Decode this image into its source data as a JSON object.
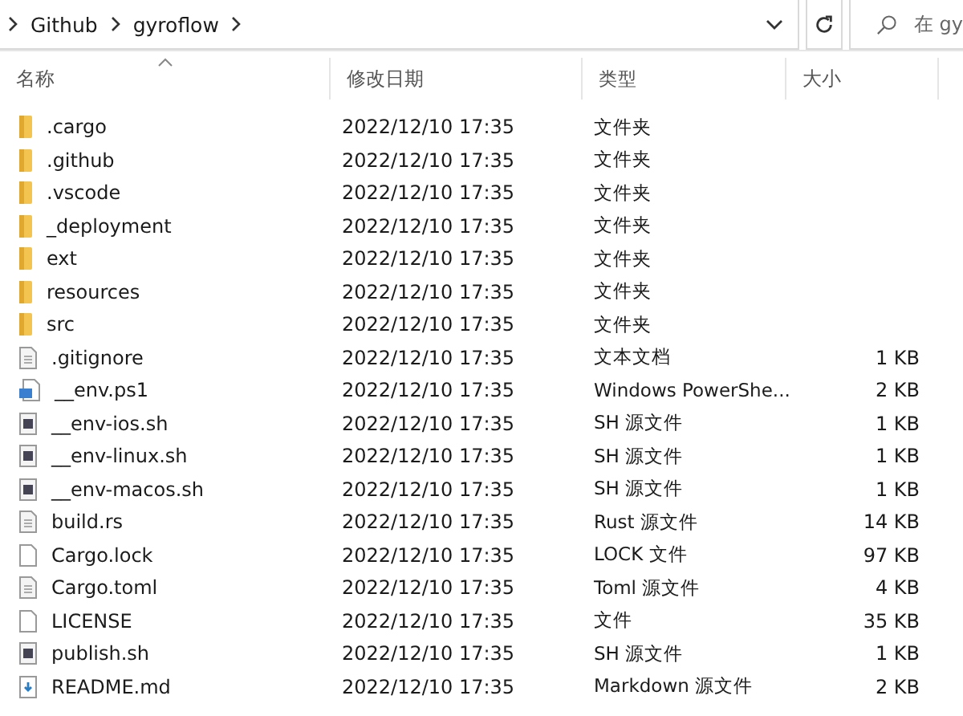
{
  "breadcrumb": [
    "Github",
    "gyroflow"
  ],
  "search": {
    "placeholder": "在 gy"
  },
  "columns": [
    {
      "label": "名称",
      "sorted": true
    },
    {
      "label": "修改日期",
      "sorted": false
    },
    {
      "label": "类型",
      "sorted": false
    },
    {
      "label": "大小",
      "sorted": false
    }
  ],
  "rows": [
    {
      "kind": "folder",
      "name": ".cargo",
      "date": "2022/12/10 17:35",
      "type": "文件夹",
      "size": ""
    },
    {
      "kind": "folder",
      "name": ".github",
      "date": "2022/12/10 17:35",
      "type": "文件夹",
      "size": ""
    },
    {
      "kind": "folder",
      "name": ".vscode",
      "date": "2022/12/10 17:35",
      "type": "文件夹",
      "size": ""
    },
    {
      "kind": "folder",
      "name": "_deployment",
      "date": "2022/12/10 17:35",
      "type": "文件夹",
      "size": ""
    },
    {
      "kind": "folder",
      "name": "ext",
      "date": "2022/12/10 17:35",
      "type": "文件夹",
      "size": ""
    },
    {
      "kind": "folder",
      "name": "resources",
      "date": "2022/12/10 17:35",
      "type": "文件夹",
      "size": ""
    },
    {
      "kind": "folder",
      "name": "src",
      "date": "2022/12/10 17:35",
      "type": "文件夹",
      "size": ""
    },
    {
      "kind": "text",
      "name": ".gitignore",
      "date": "2022/12/10 17:35",
      "type": "文本文档",
      "size": "1 KB"
    },
    {
      "kind": "script",
      "name": "__env.ps1",
      "date": "2022/12/10 17:35",
      "type": "Windows PowerShe...",
      "size": "2 KB"
    },
    {
      "kind": "shell",
      "name": "__env-ios.sh",
      "date": "2022/12/10 17:35",
      "type": "SH 源文件",
      "size": "1 KB"
    },
    {
      "kind": "shell",
      "name": "__env-linux.sh",
      "date": "2022/12/10 17:35",
      "type": "SH 源文件",
      "size": "1 KB"
    },
    {
      "kind": "shell",
      "name": "__env-macos.sh",
      "date": "2022/12/10 17:35",
      "type": "SH 源文件",
      "size": "1 KB"
    },
    {
      "kind": "text",
      "name": "build.rs",
      "date": "2022/12/10 17:35",
      "type": "Rust 源文件",
      "size": "14 KB"
    },
    {
      "kind": "blank",
      "name": "Cargo.lock",
      "date": "2022/12/10 17:35",
      "type": "LOCK 文件",
      "size": "97 KB"
    },
    {
      "kind": "text",
      "name": "Cargo.toml",
      "date": "2022/12/10 17:35",
      "type": "Toml 源文件",
      "size": "4 KB"
    },
    {
      "kind": "blank",
      "name": "LICENSE",
      "date": "2022/12/10 17:35",
      "type": "文件",
      "size": "35 KB"
    },
    {
      "kind": "shell",
      "name": "publish.sh",
      "date": "2022/12/10 17:35",
      "type": "SH 源文件",
      "size": "1 KB"
    },
    {
      "kind": "markdown",
      "name": "README.md",
      "date": "2022/12/10 17:35",
      "type": "Markdown 源文件",
      "size": "2 KB"
    }
  ]
}
